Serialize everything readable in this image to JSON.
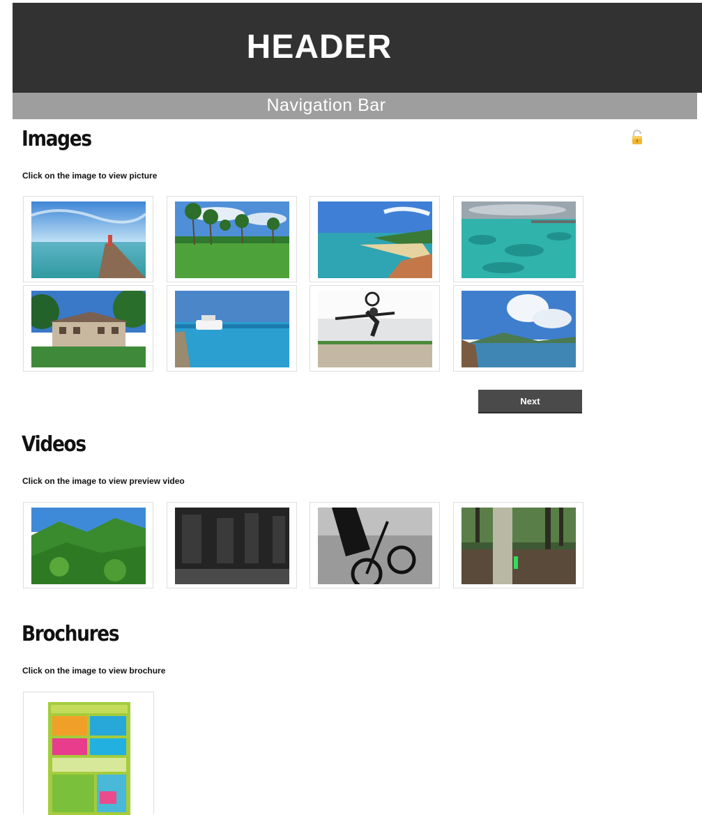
{
  "header": {
    "title": "HEADER"
  },
  "navbar": {
    "label": "Navigation Bar"
  },
  "images": {
    "title": "Images",
    "hint": "Click on the image to view picture",
    "next_label": "Next"
  },
  "videos": {
    "title": "Videos",
    "hint": "Click on the image to view preview video"
  },
  "brochures": {
    "title": "Brochures",
    "hint": "Click on the image to view brochure"
  },
  "colors": {
    "header_bg": "#323232",
    "navbar_bg": "#9e9e9e",
    "button_bg": "#4a4a4a",
    "lock": "#f2b632"
  },
  "icons": {
    "lock": "lock-icon"
  }
}
